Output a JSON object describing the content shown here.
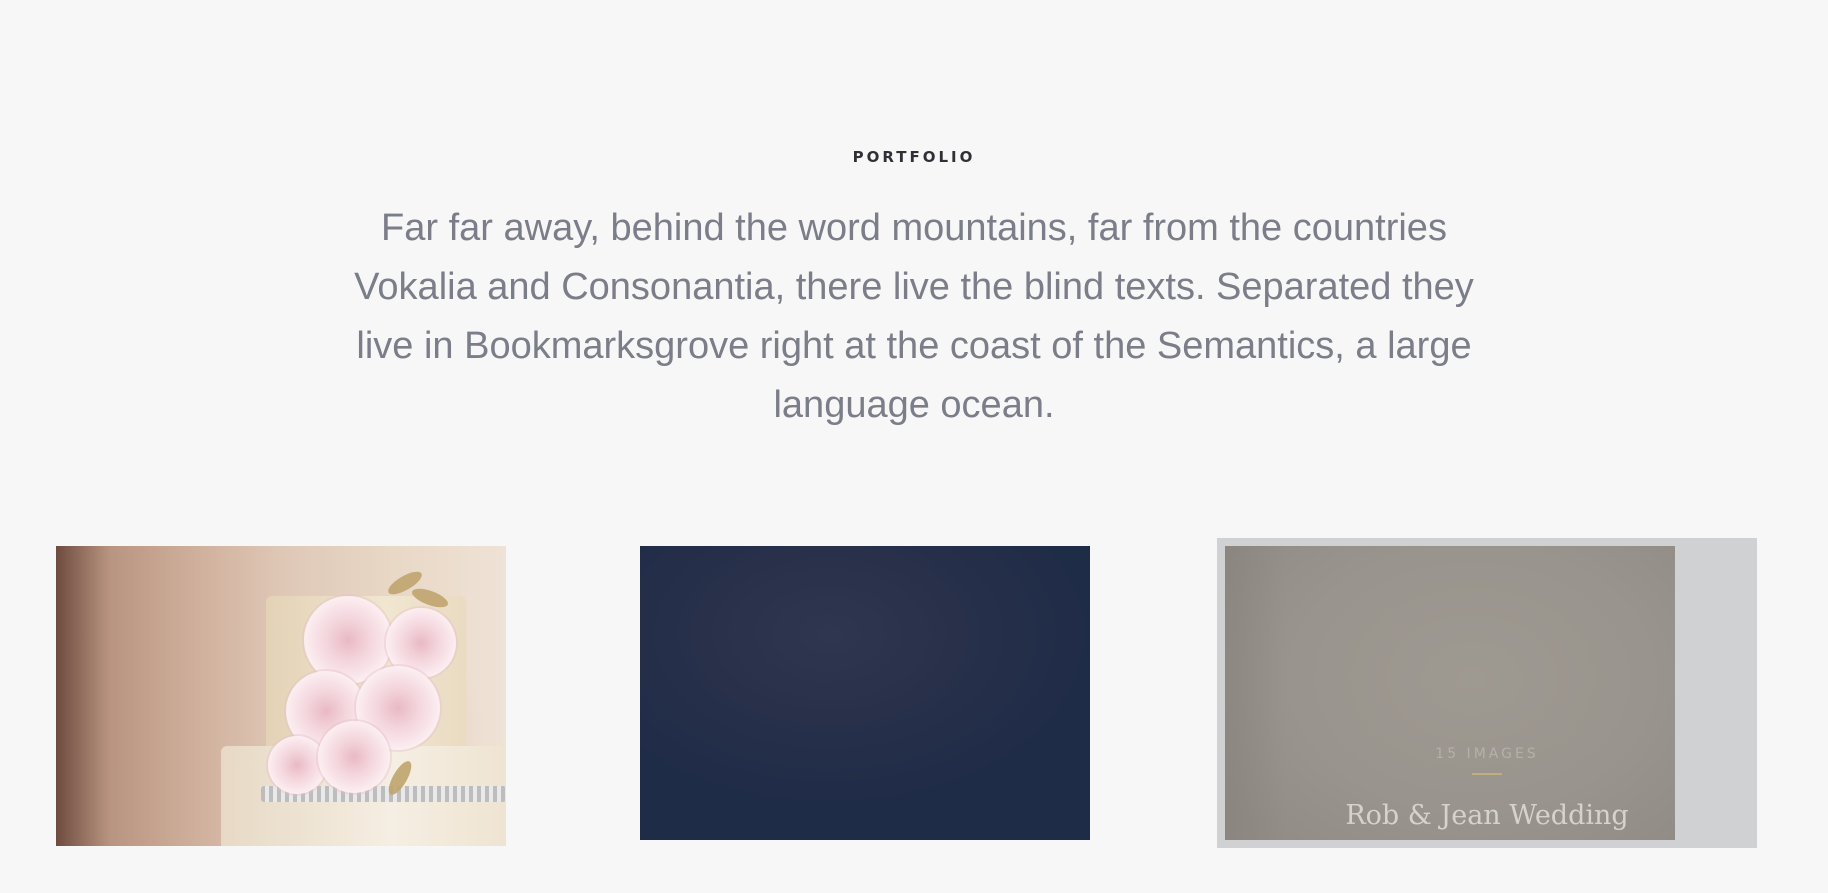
{
  "section": {
    "eyebrow": "PORTFOLIO",
    "intro": "Far far away, behind the word mountains, far from the countries Vokalia and Consonantia, there live the blind texts. Separated they live in Bookmarksgrove right at the coast of the Semantics, a large language ocean."
  },
  "portfolio": {
    "items": [
      {
        "image": "wedding-cake-photo"
      },
      {
        "image": "navy-photo"
      },
      {
        "image": "wedding-photo",
        "count": "15 IMAGES",
        "title": "Rob & Jean Wedding"
      }
    ]
  },
  "colors": {
    "background": "#f7f7f7",
    "heading": "#2f3036",
    "text": "#7b7d88",
    "accent": "#c4ad7c",
    "navy": "#1f2c48"
  }
}
